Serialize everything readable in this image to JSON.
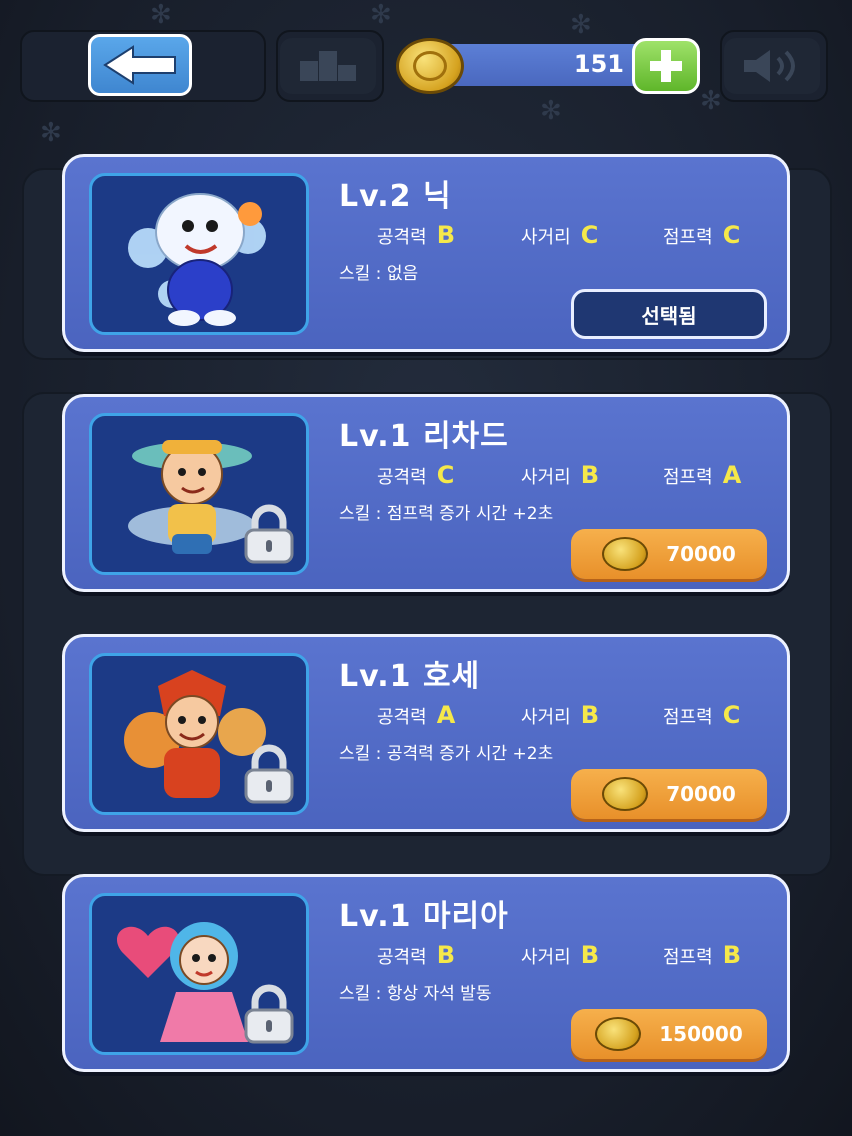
{
  "topbar": {
    "coins": "151",
    "icons": [
      "back-arrow-icon",
      "ranking-icon",
      "coin-icon",
      "plus-icon",
      "speaker-icon"
    ]
  },
  "colors": {
    "card": "#4f69c4",
    "grade": "#f5e84a",
    "price_button": "#ee9a33",
    "selected_button": "#1f3772"
  },
  "characters": [
    {
      "title": "Lv.2 닉",
      "stats": [
        {
          "label": "공격력",
          "grade": "B"
        },
        {
          "label": "사거리",
          "grade": "C"
        },
        {
          "label": "점프력",
          "grade": "C"
        }
      ],
      "skill": "스킬 : 없음",
      "action": {
        "type": "selected",
        "label": "선택됨"
      },
      "locked": false
    },
    {
      "title": "Lv.1 리차드",
      "stats": [
        {
          "label": "공격력",
          "grade": "C"
        },
        {
          "label": "사거리",
          "grade": "B"
        },
        {
          "label": "점프력",
          "grade": "A"
        }
      ],
      "skill": "스킬 : 점프력 증가 시간 +2초",
      "action": {
        "type": "price",
        "label": "70000"
      },
      "locked": true
    },
    {
      "title": "Lv.1 호세",
      "stats": [
        {
          "label": "공격력",
          "grade": "A"
        },
        {
          "label": "사거리",
          "grade": "B"
        },
        {
          "label": "점프력",
          "grade": "C"
        }
      ],
      "skill": "스킬 : 공격력 증가 시간 +2초",
      "action": {
        "type": "price",
        "label": "70000"
      },
      "locked": true
    },
    {
      "title": "Lv.1 마리아",
      "stats": [
        {
          "label": "공격력",
          "grade": "B"
        },
        {
          "label": "사거리",
          "grade": "B"
        },
        {
          "label": "점프력",
          "grade": "B"
        }
      ],
      "skill": "스킬 : 항상 자석 발동",
      "action": {
        "type": "price",
        "label": "150000"
      },
      "locked": true
    }
  ]
}
